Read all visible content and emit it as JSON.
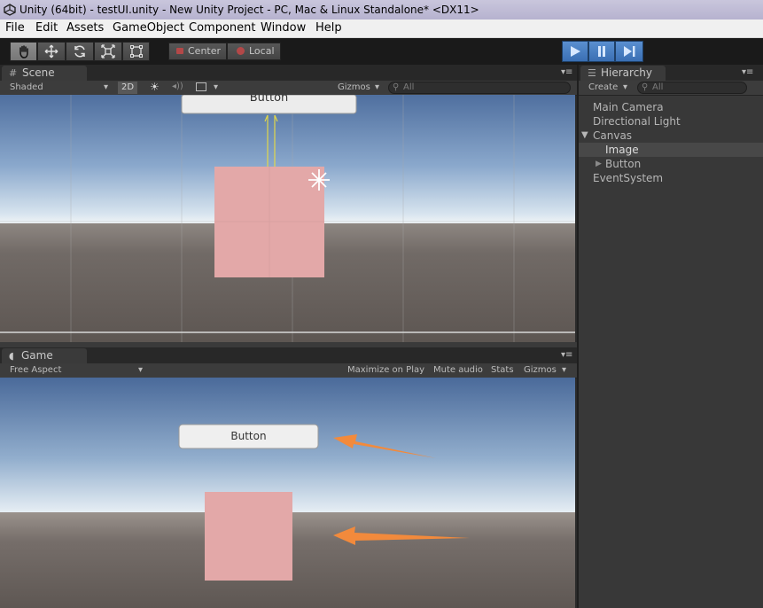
{
  "window": {
    "title": "Unity (64bit) - testUI.unity - New Unity Project - PC, Mac & Linux Standalone* <DX11>"
  },
  "menu": [
    "File",
    "Edit",
    "Assets",
    "GameObject",
    "Component",
    "Window",
    "Help"
  ],
  "toolbar": {
    "tools": [
      "hand-icon",
      "move-icon",
      "rotate-icon",
      "scale-icon",
      "rect-icon"
    ],
    "pivot_label": "Center",
    "space_label": "Local",
    "play_controls": [
      "play-icon",
      "pause-icon",
      "step-icon"
    ],
    "accent": "#4a86d4"
  },
  "scene": {
    "tab_label": "Scene",
    "shading": "Shaded",
    "mode_2d": "2D",
    "gizmos": "Gizmos",
    "search_placeholder": "All",
    "button_text": "Button",
    "image_color": "#e3a8a8"
  },
  "game": {
    "tab_label": "Game",
    "aspect": "Free Aspect",
    "options": [
      "Maximize on Play",
      "Mute audio",
      "Stats",
      "Gizmos"
    ],
    "button_text": "Button",
    "image_color": "#e3a8a8",
    "arrow_color": "#f28a3c"
  },
  "hierarchy": {
    "tab_label": "Hierarchy",
    "create": "Create",
    "search_placeholder": "All",
    "items": [
      "Main Camera",
      "Directional Light",
      "Canvas",
      "Image",
      "Button",
      "EventSystem"
    ],
    "selected": "Image"
  }
}
